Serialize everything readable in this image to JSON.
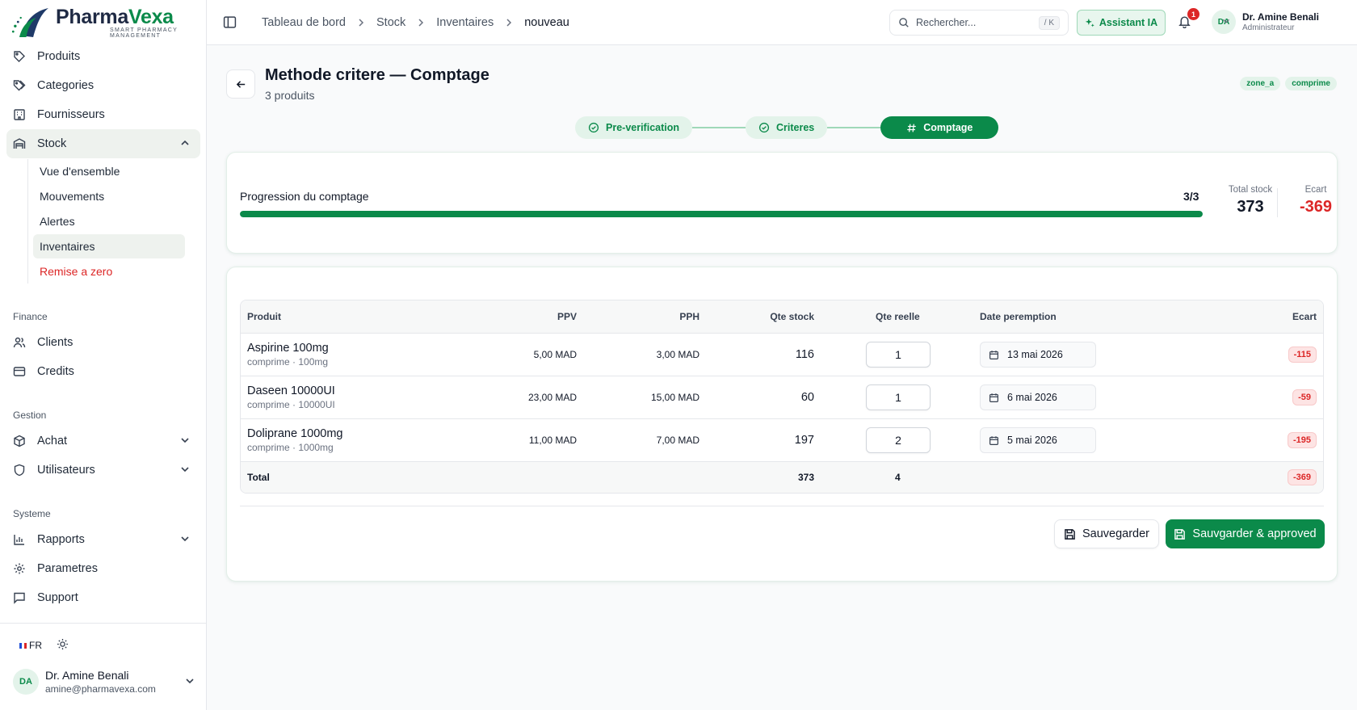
{
  "brand": {
    "name_part1": "Pharma",
    "name_part2": "Vexa",
    "tagline": "SMART PHARMACY MANAGEMENT"
  },
  "sidebar": {
    "top_items": [
      {
        "label": "Produits",
        "icon": "tag-icon"
      },
      {
        "label": "Categories",
        "icon": "tags-icon"
      },
      {
        "label": "Fournisseurs",
        "icon": "building-icon"
      }
    ],
    "stock": {
      "label": "Stock",
      "icon": "warehouse-icon",
      "expanded": true,
      "sub_items": [
        "Vue d'ensemble",
        "Mouvements",
        "Alertes",
        "Inventaires",
        "Remise a zero"
      ],
      "active_sub": "Inventaires"
    },
    "sections": {
      "finance": {
        "label": "Finance",
        "items": [
          "Clients",
          "Credits"
        ]
      },
      "gestion": {
        "label": "Gestion",
        "items": [
          "Achat",
          "Utilisateurs"
        ]
      },
      "systeme": {
        "label": "Systeme",
        "items": [
          "Rapports",
          "Parametres",
          "Support"
        ]
      }
    },
    "language": "FR",
    "user": {
      "initials": "DA",
      "name": "Dr. Amine Benali",
      "email": "amine@pharmavexa.com"
    }
  },
  "header": {
    "breadcrumb": [
      "Tableau de bord",
      "Stock",
      "Inventaires",
      "nouveau"
    ],
    "search": {
      "placeholder": "Rechercher...",
      "shortcut": "/ K"
    },
    "ai_button": "Assistant IA",
    "notifications": "1",
    "user": {
      "initials": "DA",
      "name": "Dr. Amine Benali",
      "role": "Administrateur"
    }
  },
  "page": {
    "title": "Methode critere — Comptage",
    "subtitle": "3 produits",
    "tags": [
      "zone_a",
      "comprime"
    ],
    "steps": [
      {
        "label": "Pre-verification",
        "state": "done"
      },
      {
        "label": "Criteres",
        "state": "done"
      },
      {
        "label": "Comptage",
        "state": "current"
      }
    ]
  },
  "progress": {
    "label": "Progression du comptage",
    "count_text": "3/3",
    "fraction": 1.0,
    "total_stock_label": "Total stock",
    "total_stock": "373",
    "ecart_label": "Ecart",
    "ecart": "-369"
  },
  "table": {
    "headers": {
      "produit": "Produit",
      "ppv": "PPV",
      "pph": "PPH",
      "qte_stock": "Qte stock",
      "qte_reelle": "Qte reelle",
      "date": "Date peremption",
      "ecart": "Ecart"
    },
    "rows": [
      {
        "name": "Aspirine 100mg",
        "sub": "comprime · 100mg",
        "ppv": "5,00 MAD",
        "pph": "3,00 MAD",
        "qte_stock": "116",
        "qte_reelle": "1",
        "date": "13 mai 2026",
        "ecart": "-115"
      },
      {
        "name": "Daseen 10000UI",
        "sub": "comprime · 10000UI",
        "ppv": "23,00 MAD",
        "pph": "15,00 MAD",
        "qte_stock": "60",
        "qte_reelle": "1",
        "date": "6 mai 2026",
        "ecart": "-59"
      },
      {
        "name": "Doliprane 1000mg",
        "sub": "comprime · 1000mg",
        "ppv": "11,00 MAD",
        "pph": "7,00 MAD",
        "qte_stock": "197",
        "qte_reelle": "2",
        "date": "5 mai 2026",
        "ecart": "-195"
      }
    ],
    "footer": {
      "label": "Total",
      "qte_stock": "373",
      "qte_reelle": "4",
      "ecart": "-369"
    }
  },
  "actions": {
    "save": "Sauvegarder",
    "save_approve": "Sauvgarder & approved"
  },
  "colors": {
    "accent": "#0b8a4a",
    "danger": "#dc2626"
  }
}
